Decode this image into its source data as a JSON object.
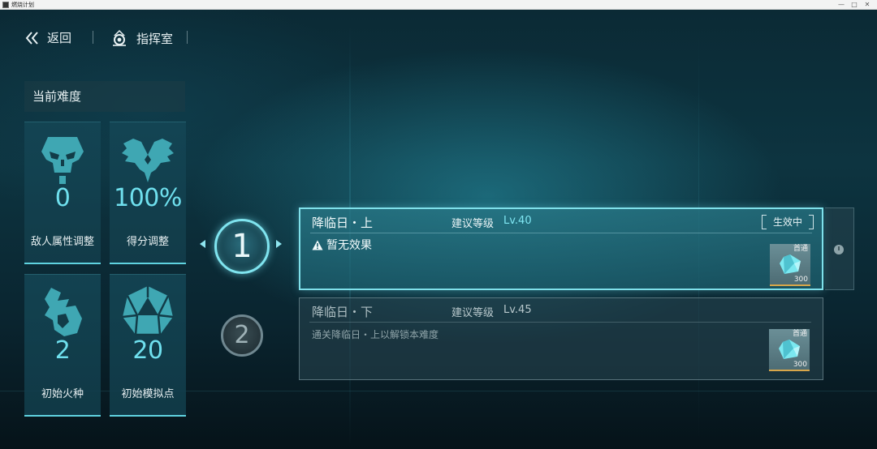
{
  "window": {
    "title": "燃烧计划",
    "controls": [
      "—",
      "□",
      "✕"
    ]
  },
  "nav": {
    "back_label": "返回",
    "room_label": "指挥室"
  },
  "difficulty": {
    "header": "当前难度",
    "cards": [
      {
        "value": "0",
        "label": "敌人属性调整",
        "icon": "enemy-skull-icon"
      },
      {
        "value": "100%",
        "label": "得分调整",
        "icon": "eagle-emblem-icon"
      },
      {
        "value": "2",
        "label": "初始火种",
        "icon": "flame-emblem-icon"
      },
      {
        "value": "20",
        "label": "初始模拟点",
        "icon": "polyhedron-icon"
      }
    ]
  },
  "stages": [
    {
      "number": "1",
      "name": "降临日・上",
      "level_label": "建议等级",
      "level_value": "Lv.40",
      "status": "生效中",
      "effect": "暂无效果",
      "reward": {
        "tag": "首通",
        "count": "300"
      }
    },
    {
      "number": "2",
      "name": "降临日・下",
      "level_label": "建议等级",
      "level_value": "Lv.45",
      "unlock_note": "通关降临日・上以解锁本难度",
      "reward": {
        "tag": "首通",
        "count": "300"
      }
    }
  ],
  "colors": {
    "accent": "#7fe0ea",
    "value_cyan": "#6fe0ee",
    "reward_bar": "#d7a64a"
  }
}
